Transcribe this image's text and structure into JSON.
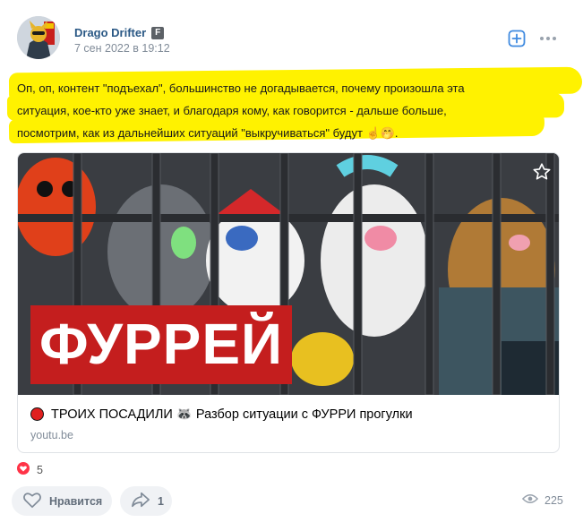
{
  "post": {
    "author": "Drago Drifter",
    "badge": "F",
    "date": "7 сен 2022 в 19:12",
    "text_lines": [
      "Оп, оп, контент \"подъехал\", большинство не догадывается, почему произошла эта",
      "ситуация, кое-кто уже знает, и благодаря кому, как говорится - дальше больше,",
      "посмотрим, как из дальнейших ситуаций \"выкручиваться\" будут ☝️🤭."
    ],
    "highlight_color": "#fff200"
  },
  "attachment": {
    "thumbnail_caption": "ФУРРЕЙ",
    "title": "ТРОИХ ПОСАДИЛИ 🦝 Разбор ситуации с ФУРРИ прогулки",
    "domain": "youtu.be"
  },
  "reactions": {
    "count": "5"
  },
  "actions": {
    "like_label": "Нравится",
    "share_count": "1"
  },
  "views": "225",
  "icons": [
    "add-to-bookmarks-icon",
    "more-icon",
    "star-icon",
    "heart-icon",
    "share-icon",
    "eye-icon"
  ],
  "colors": {
    "accent": "#2a5885",
    "secondary_text": "#818c99",
    "pill_bg": "#f0f2f5",
    "thumbnail_red": "#c41e1e"
  }
}
